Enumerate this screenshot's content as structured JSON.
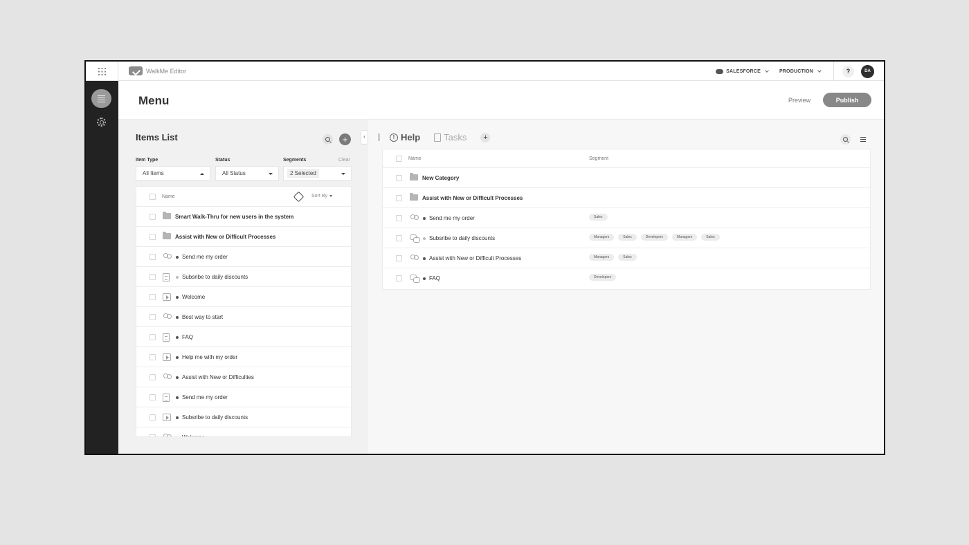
{
  "app": {
    "name": "WalkMe Editor"
  },
  "topbar": {
    "environment": "SALESFORCE",
    "stage": "PRODUCTION",
    "help": "?",
    "avatar": "DA"
  },
  "header": {
    "title": "Menu",
    "preview": "Preview",
    "publish": "Publish"
  },
  "items_panel": {
    "title": "Items List",
    "filters": {
      "item_type_label": "Item Type",
      "item_type_value": "All Items",
      "status_label": "Status",
      "status_value": "All Status",
      "segments_label": "Segments",
      "segments_value": "2 Selected",
      "clear": "Clear"
    },
    "list_header": {
      "name": "Name",
      "sort": "Sort By"
    },
    "items": [
      {
        "label": "Smart Walk-Thru for new users in the system",
        "icon": "folder-icon",
        "kind": "folder"
      },
      {
        "label": "Assist with New or Difficult Processes",
        "icon": "folder-icon",
        "kind": "folder"
      },
      {
        "label": "Send me my order",
        "icon": "people-icon",
        "status": "dark"
      },
      {
        "label": "Subsribe to daily discounts",
        "icon": "document-icon",
        "status": "light"
      },
      {
        "label": "Welcome",
        "icon": "video-icon",
        "status": "dark"
      },
      {
        "label": "Best way to start",
        "icon": "people-icon",
        "status": "dark"
      },
      {
        "label": "FAQ",
        "icon": "document-icon",
        "status": "dark"
      },
      {
        "label": "Help me with my order",
        "icon": "video-icon",
        "status": "dark"
      },
      {
        "label": "Assist with New or Difficulties",
        "icon": "people-icon",
        "status": "dark"
      },
      {
        "label": "Send me my order",
        "icon": "document-icon",
        "status": "dark"
      },
      {
        "label": "Subsribe to daily discounts",
        "icon": "video-icon",
        "status": "dark"
      },
      {
        "label": "Welcome",
        "icon": "people-icon",
        "status": "dark"
      }
    ]
  },
  "menu_panel": {
    "tabs": [
      {
        "label": "Help",
        "icon": "info-icon",
        "active": true
      },
      {
        "label": "Tasks",
        "icon": "clipboard-icon",
        "active": false
      }
    ],
    "table_header": {
      "name": "Name",
      "segment": "Segment"
    },
    "rows": [
      {
        "label": "New Category",
        "icon": "folder-icon",
        "kind": "folder",
        "segments": []
      },
      {
        "label": "Assist with New or Difficult Processes",
        "icon": "folder-icon",
        "kind": "folder",
        "segments": []
      },
      {
        "label": "Send me my order",
        "icon": "people-icon",
        "status": "dark",
        "segments": [
          "Sales"
        ]
      },
      {
        "label": "Subsribe to daily discounts",
        "icon": "chat-icon",
        "status": "light",
        "segments": [
          "Managers",
          "Sales",
          "Developers",
          "Managers",
          "Sales"
        ]
      },
      {
        "label": "Assist with New or Difficult Processes",
        "icon": "people-icon",
        "status": "dark",
        "segments": [
          "Managers",
          "Sales"
        ]
      },
      {
        "label": "FAQ",
        "icon": "chat-icon",
        "status": "dark",
        "segments": [
          "Developers"
        ]
      }
    ]
  }
}
